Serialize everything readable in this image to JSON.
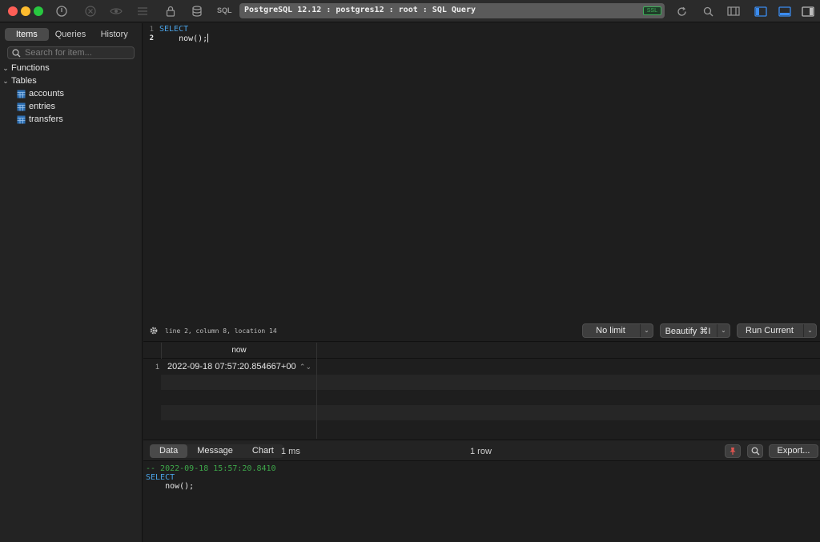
{
  "toolbar": {
    "sql_label": "SQL",
    "connection_title": "PostgreSQL 12.12 : postgres12 : root : SQL Query",
    "connection_badge": "SSL",
    "icons": [
      "power-icon",
      "close-circle-icon",
      "eye-icon",
      "list-icon",
      "lock-icon",
      "database-icon",
      "refresh-icon",
      "search-icon",
      "columns-icon",
      "left-panel-icon",
      "bottom-panel-icon",
      "right-panel-icon"
    ]
  },
  "sidebar": {
    "tabs": [
      "Items",
      "Queries",
      "History"
    ],
    "active_tab": "Items",
    "search_placeholder": "Search for item...",
    "groups": [
      {
        "label": "Functions"
      },
      {
        "label": "Tables"
      }
    ],
    "tables": [
      "accounts",
      "entries",
      "transfers"
    ]
  },
  "editor": {
    "line_numbers": [
      "1",
      "2"
    ],
    "line1_keyword": "SELECT",
    "line2_code": "    now();",
    "cursor_info": "line 2, column 8, location 14",
    "limit_button": "No limit",
    "beautify_button": "Beautify ⌘I",
    "run_button": "Run Current"
  },
  "results": {
    "columns": [
      "now"
    ],
    "rows": [
      {
        "num": "1",
        "values": [
          "2022-09-18 07:57:20.854667+00"
        ]
      }
    ]
  },
  "result_bar": {
    "tabs": [
      "Data",
      "Message",
      "Chart"
    ],
    "active_tab": "Data",
    "duration": "1 ms",
    "row_count": "1 row",
    "export_button": "Export..."
  },
  "log": {
    "comment": "-- 2022-09-18 15:57:20.8410",
    "line2": "SELECT",
    "line3": "    now();"
  },
  "colors": {
    "keyword": "#4aa3e6",
    "comment": "#3ea84a",
    "badge": "#3fae5a"
  }
}
